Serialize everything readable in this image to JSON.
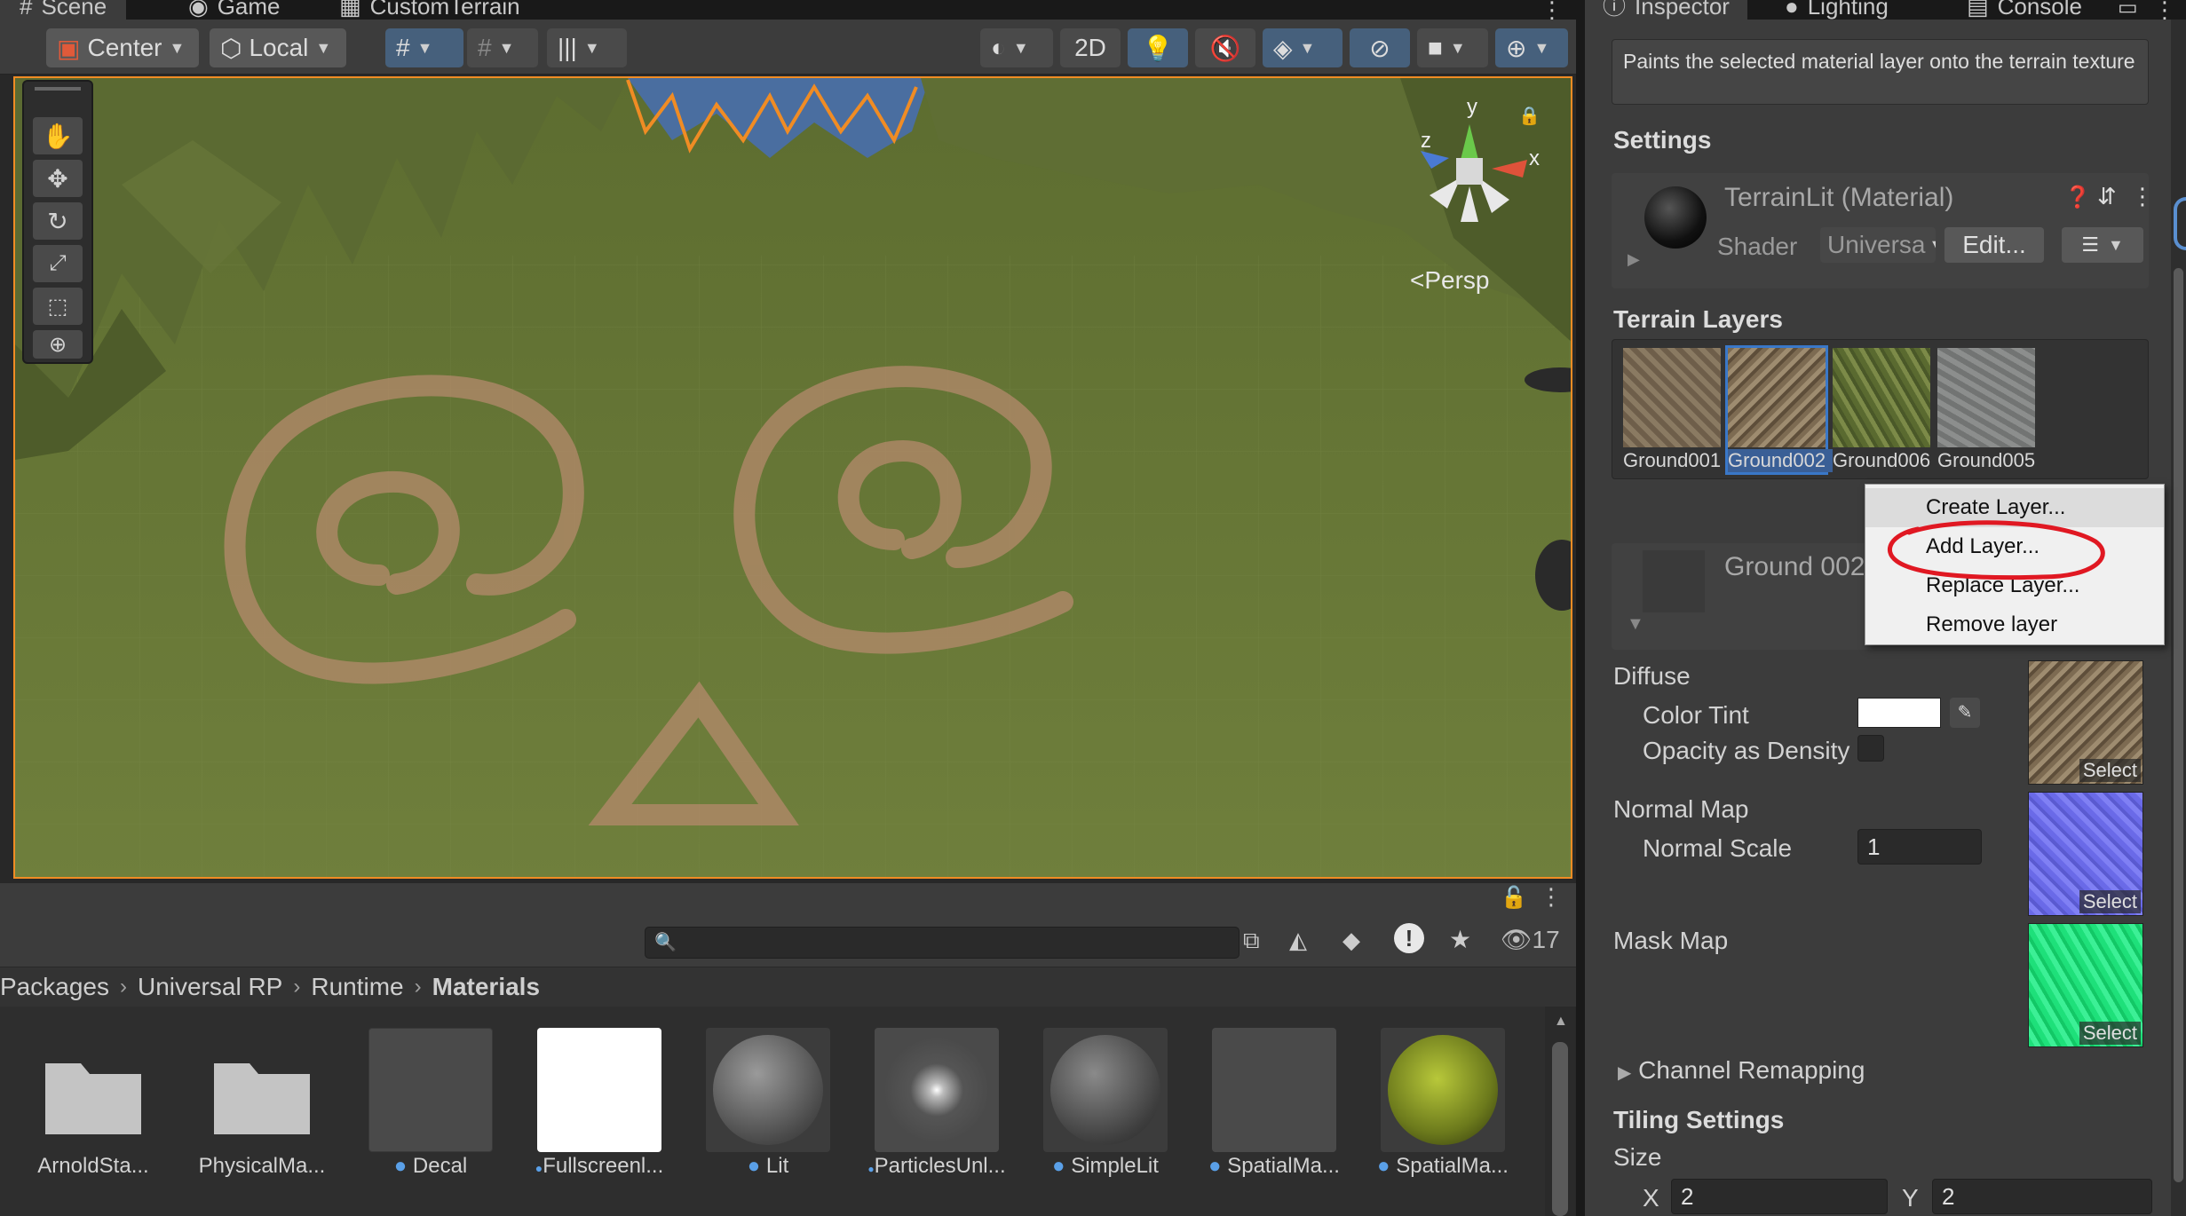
{
  "scene_tabs": [
    {
      "label": "Scene",
      "icon": "hash-icon"
    },
    {
      "label": "Game",
      "icon": "gamepad-icon"
    },
    {
      "label": "CustomTerrain",
      "icon": "grid-icon"
    }
  ],
  "toolbar": {
    "pivot_mode": "Center",
    "pivot_rotation": "Local",
    "mode_2d": "2D"
  },
  "scene_view": {
    "projection_label": "Persp",
    "gizmo_axes": {
      "x": "x",
      "y": "y",
      "z": "z"
    }
  },
  "project": {
    "breadcrumb": [
      "Packages",
      "Universal RP",
      "Runtime",
      "Materials"
    ],
    "hidden_count": "17",
    "search_placeholder": "",
    "assets": [
      {
        "name": "ArnoldSta...",
        "kind": "folder"
      },
      {
        "name": "PhysicalMa...",
        "kind": "folder"
      },
      {
        "name": "Decal",
        "kind": "material"
      },
      {
        "name": "Fullscreenl...",
        "kind": "material"
      },
      {
        "name": "Lit",
        "kind": "material"
      },
      {
        "name": "ParticlesUnl...",
        "kind": "material"
      },
      {
        "name": "SimpleLit",
        "kind": "material"
      },
      {
        "name": "SpatialMa...",
        "kind": "material"
      },
      {
        "name": "SpatialMa...",
        "kind": "material"
      }
    ]
  },
  "inspector": {
    "tabs": [
      "Inspector",
      "Lighting",
      "Console"
    ],
    "help_text": "Paints the selected material layer onto the terrain texture",
    "settings_heading": "Settings",
    "material_name": "TerrainLit (Material)",
    "shader_label": "Shader",
    "shader_value": "Universa",
    "edit_button": "Edit...",
    "terrain_layers_heading": "Terrain Layers",
    "layers": [
      {
        "name": "Ground001",
        "selected": false,
        "color": "#7d6b55"
      },
      {
        "name": "Ground002",
        "selected": true,
        "color": "#8d7b62"
      },
      {
        "name": "Ground006",
        "selected": false,
        "color": "#6b7a3e"
      },
      {
        "name": "Ground005",
        "selected": false,
        "color": "#7f8180"
      }
    ],
    "layer_detail_name": "Ground 002",
    "diffuse_heading": "Diffuse",
    "color_tint_label": "Color Tint",
    "opacity_label": "Opacity as Density",
    "normal_map_heading": "Normal Map",
    "normal_scale_label": "Normal Scale",
    "normal_scale_value": "1",
    "mask_map_heading": "Mask Map",
    "select_label": "Select",
    "channel_remapping": "Channel Remapping",
    "tiling_heading": "Tiling Settings",
    "size_label": "Size",
    "size_x_label": "X",
    "size_x": "2",
    "size_y_label": "Y",
    "size_y": "2"
  },
  "context_menu": {
    "items": [
      "Create Layer...",
      "Add Layer...",
      "Replace Layer...",
      "Remove layer"
    ],
    "highlighted": "Add Layer..."
  },
  "colors": {
    "selection_outline": "#f08c24",
    "annotation": "#e01822",
    "accent": "#3a78c8"
  }
}
